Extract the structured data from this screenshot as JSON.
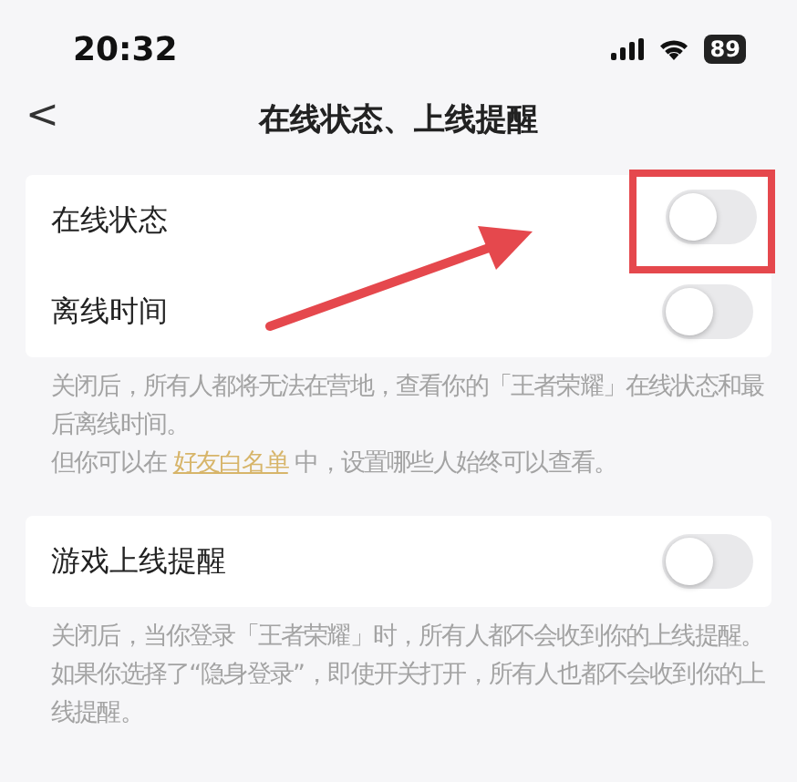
{
  "status_bar": {
    "time": "20:32",
    "battery": "89"
  },
  "nav": {
    "back": "<",
    "title": "在线状态、上线提醒"
  },
  "sections": [
    {
      "rows": [
        {
          "label": "在线状态",
          "on": false,
          "highlighted": true
        },
        {
          "label": "离线时间",
          "on": false,
          "highlighted": false
        }
      ],
      "notes": [
        {
          "text": "关闭后，所有人都将无法在营地，查看你的「王者荣耀」在线状态和最后离线时间。"
        },
        {
          "before": "但你可以在 ",
          "link": "好友白名单",
          "after": " 中，设置哪些人始终可以查看。"
        }
      ]
    },
    {
      "rows": [
        {
          "label": "游戏上线提醒",
          "on": false,
          "highlighted": false
        }
      ],
      "notes": [
        {
          "text": "关闭后，当你登录「王者荣耀」时，所有人都不会收到你的上线提醒。"
        },
        {
          "text": "如果你选择了“隐身登录”，即使开关打开，所有人也都不会收到你的上线提醒。"
        }
      ]
    }
  ]
}
